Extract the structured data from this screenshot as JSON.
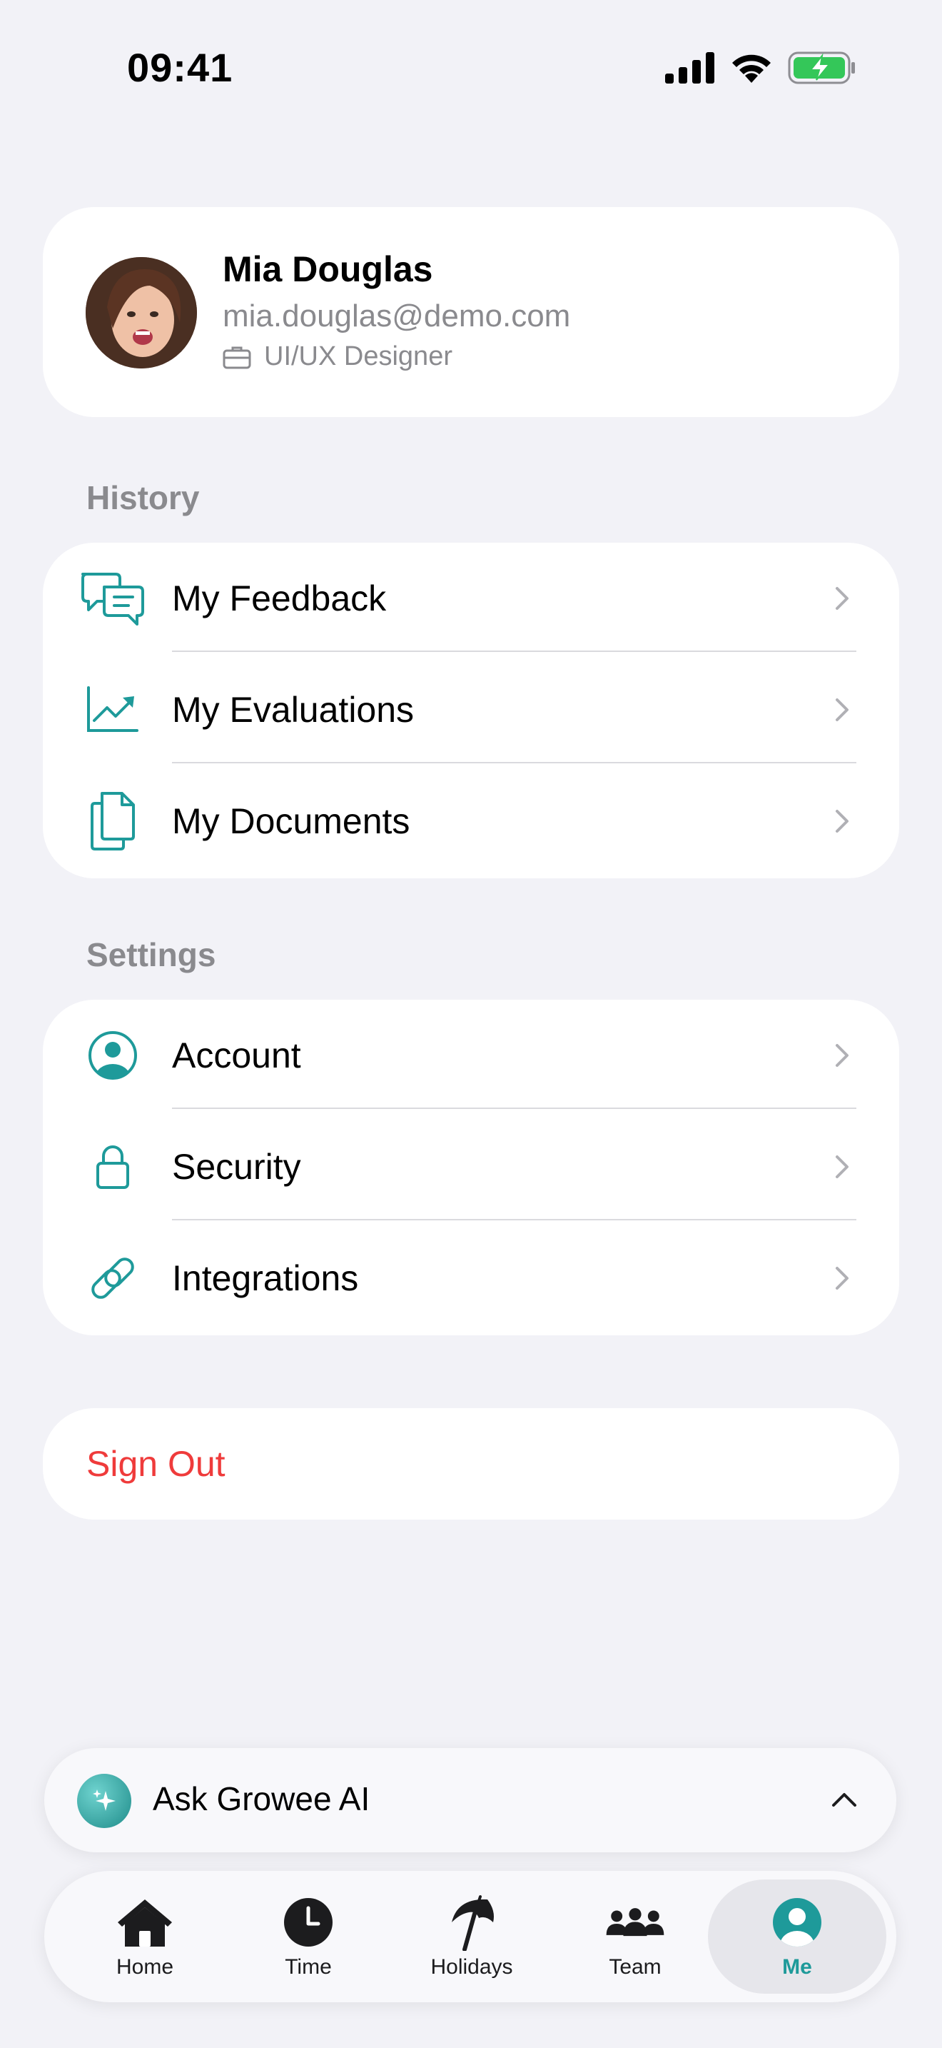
{
  "status_bar": {
    "time": "09:41"
  },
  "profile": {
    "name": "Mia Douglas",
    "email": "mia.douglas@demo.com",
    "role": "UI/UX Designer"
  },
  "history": {
    "label": "History",
    "items": [
      {
        "label": "My Feedback",
        "icon": "feedback-icon"
      },
      {
        "label": "My Evaluations",
        "icon": "chart-trend-icon"
      },
      {
        "label": "My Documents",
        "icon": "documents-icon"
      }
    ]
  },
  "settings": {
    "label": "Settings",
    "items": [
      {
        "label": "Account",
        "icon": "account-icon"
      },
      {
        "label": "Security",
        "icon": "lock-icon"
      },
      {
        "label": "Integrations",
        "icon": "link-icon"
      }
    ]
  },
  "sign_out": {
    "label": "Sign Out"
  },
  "ask_ai": {
    "label": "Ask Growee AI"
  },
  "tabs": [
    {
      "label": "Home",
      "icon": "home-icon"
    },
    {
      "label": "Time",
      "icon": "clock-icon"
    },
    {
      "label": "Holidays",
      "icon": "umbrella-icon"
    },
    {
      "label": "Team",
      "icon": "team-icon"
    },
    {
      "label": "Me",
      "icon": "person-icon",
      "active": true
    }
  ],
  "colors": {
    "accent": "#1E9A9A",
    "danger": "#EF3B3B",
    "background": "#F2F2F7",
    "secondary_text": "#8A8A8E"
  }
}
